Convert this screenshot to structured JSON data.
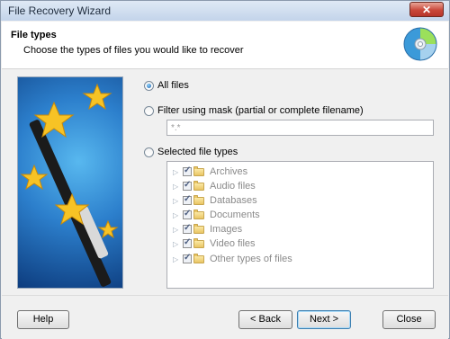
{
  "window": {
    "title": "File Recovery Wizard",
    "close_glyph": "✕"
  },
  "header": {
    "title": "File types",
    "subtitle": "Choose the types of files you would like to recover",
    "icon": "disc-recovery-icon"
  },
  "options": {
    "all_files": "All files",
    "filter_mask": "Filter using mask (partial or complete filename)",
    "mask_value": "*.*",
    "selected_types": "Selected file types",
    "selected": "all_files"
  },
  "file_types": [
    {
      "label": "Archives",
      "checked": true
    },
    {
      "label": "Audio files",
      "checked": true
    },
    {
      "label": "Databases",
      "checked": true
    },
    {
      "label": "Documents",
      "checked": true
    },
    {
      "label": "Images",
      "checked": true
    },
    {
      "label": "Video files",
      "checked": true
    },
    {
      "label": "Other types of files",
      "checked": true
    }
  ],
  "buttons": {
    "help": "Help",
    "back": "< Back",
    "next": "Next >",
    "close": "Close"
  },
  "colors": {
    "accent": "#3c7fb1",
    "close_button": "#c9483a",
    "panel_blue": "#2c7fcc"
  }
}
